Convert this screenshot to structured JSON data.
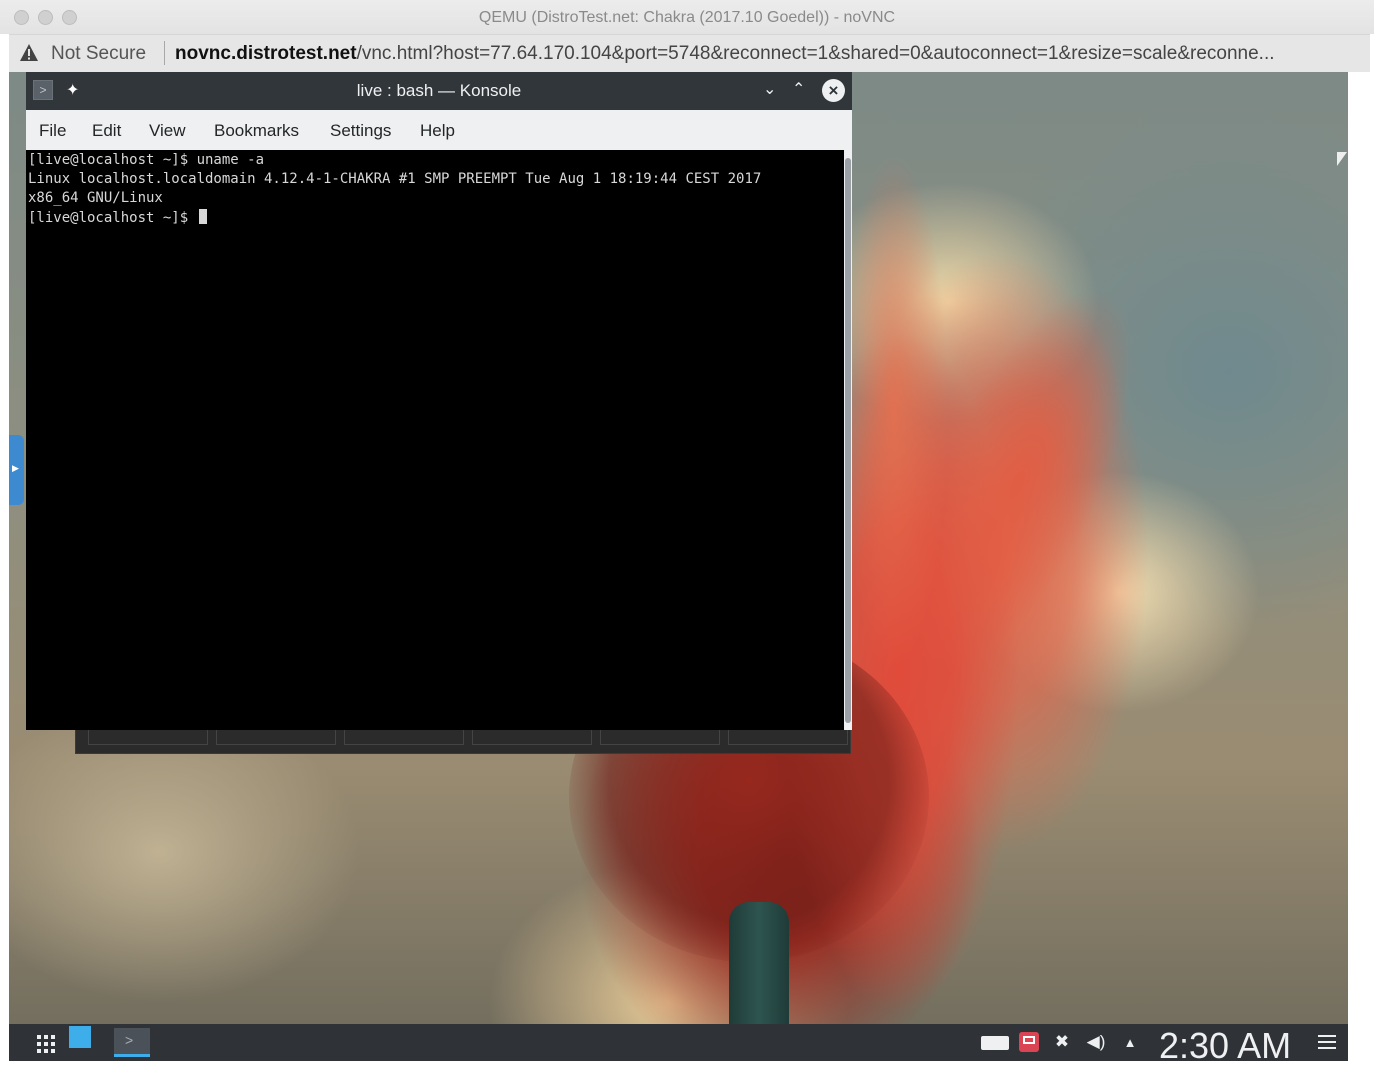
{
  "browser": {
    "window_title": "QEMU (DistroTest.net: Chakra (2017.10 Goedel)) - noVNC",
    "security_label": "Not Secure",
    "url_host": "novnc.distrotest.net",
    "url_path": "/vnc.html?host=77.64.170.104&port=5748&reconnect=1&shared=0&autoconnect=1&resize=scale&reconne..."
  },
  "konsole": {
    "title": "live : bash — Konsole",
    "menu": [
      "File",
      "Edit",
      "View",
      "Bookmarks",
      "Settings",
      "Help"
    ],
    "terminal_lines": [
      "[live@localhost ~]$ uname -a",
      "Linux localhost.localdomain 4.12.4-1-CHAKRA #1 SMP PREEMPT Tue Aug 1 18:19:44 CEST 2017",
      "x86_64 GNU/Linux",
      "[live@localhost ~]$ "
    ]
  },
  "panel": {
    "clock": "2:30 AM"
  },
  "icons": {
    "title_pin": "pin-icon",
    "minimize": "chevron-down-icon",
    "maximize": "chevron-up-icon",
    "close": "close-icon",
    "launcher": "app-launcher-icon",
    "tray": [
      "network-icon",
      "mail-icon",
      "updates-icon",
      "volume-icon",
      "expand-tray-icon"
    ],
    "menu": "hamburger-menu-icon"
  },
  "colors": {
    "konsole_chrome": "#31363b",
    "menubar": "#eff0f1",
    "terminal_bg": "#000000",
    "accent": "#3daee9"
  }
}
